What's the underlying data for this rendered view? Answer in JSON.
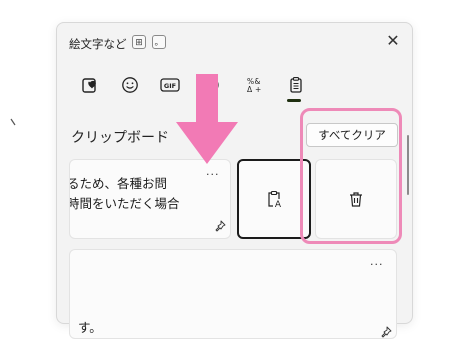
{
  "window": {
    "title": "絵文字など",
    "shortcut_keys": [
      "⊞",
      "。"
    ],
    "close_label": "✕"
  },
  "tabs": [
    {
      "name": "emoji-favorites",
      "icon": "heart-note-icon"
    },
    {
      "name": "emoji",
      "icon": "smiley-icon"
    },
    {
      "name": "gif",
      "icon": "gif-icon",
      "label": "GIF"
    },
    {
      "name": "kaomoji",
      "icon": "kaomoji-icon"
    },
    {
      "name": "symbols",
      "icon": "symbols-icon"
    },
    {
      "name": "clipboard",
      "icon": "clipboard-icon",
      "selected": true
    }
  ],
  "clipboard": {
    "section_title": "クリップボード",
    "clear_all_label": "すべてクリア",
    "items": [
      {
        "line1": "るため、各種お問",
        "line2": "時間をいただく場合",
        "more_label": "···"
      },
      {
        "line1": "す。",
        "more_label": "···"
      }
    ]
  },
  "annotations": {
    "highlight_color": "#ee8ab8",
    "arrow_color": "#f27ab5"
  }
}
